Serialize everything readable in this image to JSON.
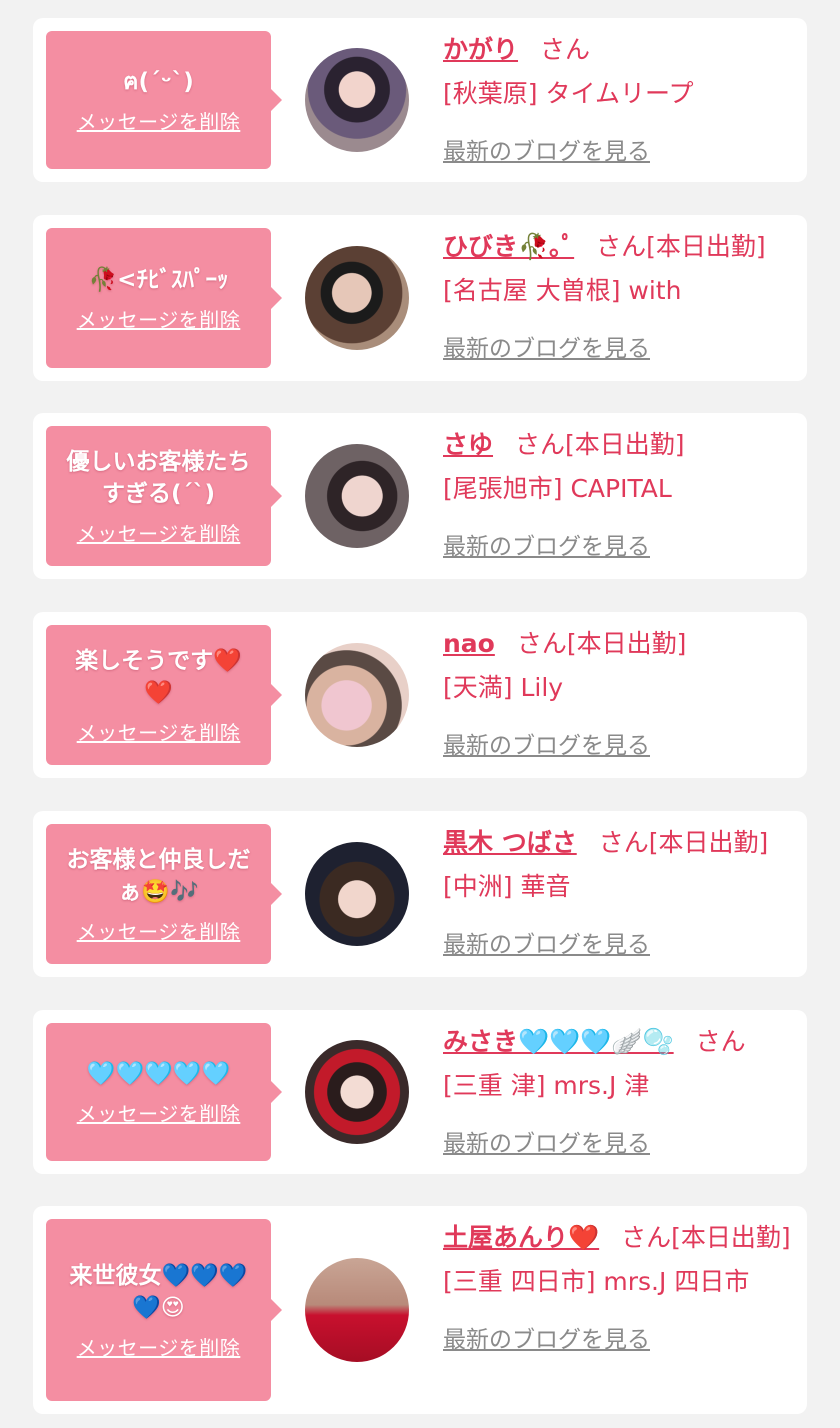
{
  "accent_color": "#e0395a",
  "bubble_color": "#f48ea2",
  "delete_label": "メッセージを削除",
  "blog_label": "最新のブログを見る",
  "cards": [
    {
      "message": "ฅ(ˊᵕˋ)",
      "name": "かがり",
      "suffix": "さん",
      "shop": "[秋葉原] タイムリープ"
    },
    {
      "message": "🥀<ﾁﾋﾞｽﾊﾟｰｯ",
      "name": "ひびき🥀｡ﾟ",
      "suffix": "さん[本日出勤]",
      "shop": "[名古屋 大曽根] with"
    },
    {
      "message": "優しいお客様たち\nすぎる(´`)",
      "name": "さゆ",
      "suffix": "さん[本日出勤]",
      "shop": "[尾張旭市] CAPITAL"
    },
    {
      "message": "楽しそうです❤️\n❤️",
      "name": "nao",
      "suffix": "さん[本日出勤]",
      "shop": "[天満] Lily"
    },
    {
      "message": "お客様と仲良しだ\nぁ🤩🎶",
      "name": "黒木 つばさ",
      "suffix": "さん[本日出勤]",
      "shop": "[中洲] 華音"
    },
    {
      "message": "🩵🩵🩵🩵🩵",
      "name": "みさき🩵🩵🩵🪽🫧",
      "suffix": "さん",
      "shop": "[三重 津] mrs.J 津"
    },
    {
      "message": "来世彼女💙💙💙\n💙😍",
      "name": "土屋あんり❤️",
      "suffix": "さん[本日出勤]",
      "shop": "[三重 四日市] mrs.J 四日市"
    }
  ]
}
